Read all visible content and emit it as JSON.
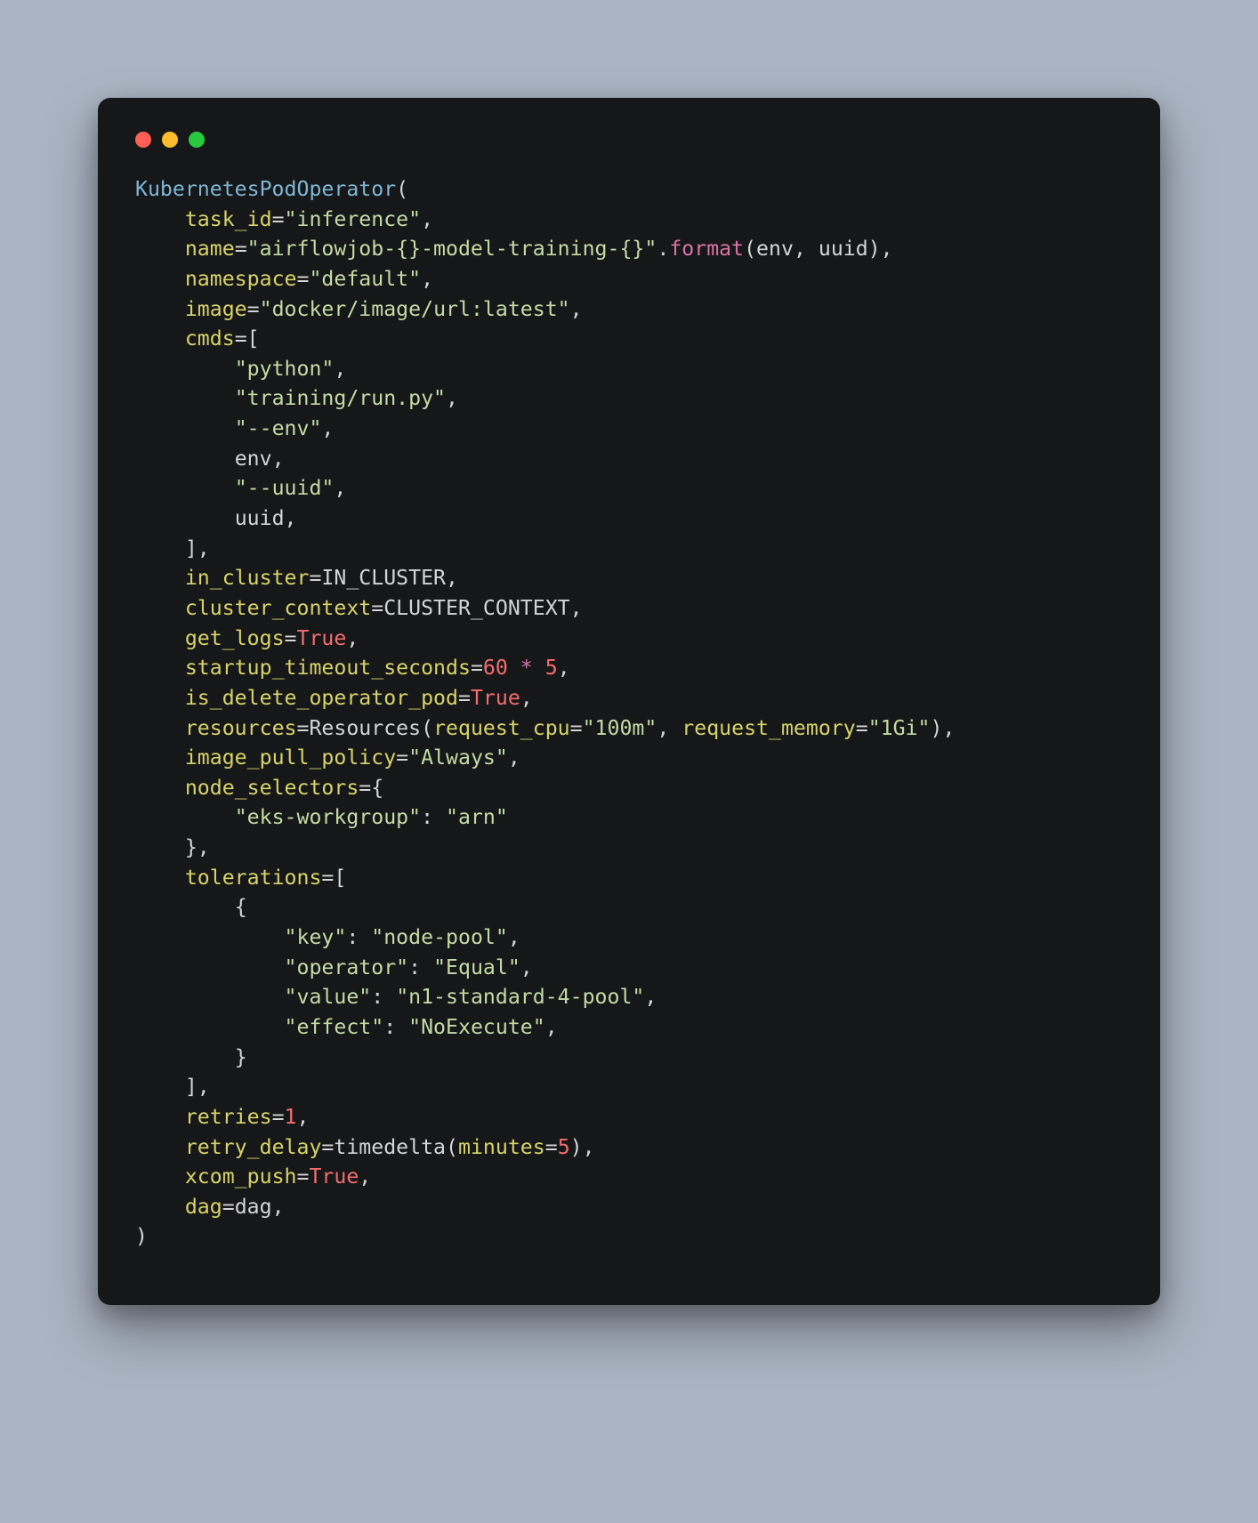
{
  "window": {
    "traffic_colors": {
      "red": "#ff5f56",
      "yellow": "#ffbd2e",
      "green": "#27c93f"
    }
  },
  "code": {
    "class_name": "KubernetesPodOperator",
    "params": {
      "task_id": {
        "key": "task_id",
        "value": "\"inference\""
      },
      "name": {
        "key": "name",
        "template": "\"airflowjob-{}-model-training-{}\"",
        "method": "format",
        "args": [
          "env",
          "uuid"
        ]
      },
      "namespace": {
        "key": "namespace",
        "value": "\"default\""
      },
      "image": {
        "key": "image",
        "value": "\"docker/image/url:latest\""
      },
      "cmds": {
        "key": "cmds",
        "items": [
          "\"python\"",
          "\"training/run.py\"",
          "\"--env\"",
          "env",
          "\"--uuid\"",
          "uuid"
        ]
      },
      "in_cluster": {
        "key": "in_cluster",
        "value": "IN_CLUSTER"
      },
      "cluster_context": {
        "key": "cluster_context",
        "value": "CLUSTER_CONTEXT"
      },
      "get_logs": {
        "key": "get_logs",
        "value": "True"
      },
      "startup_timeout_seconds": {
        "key": "startup_timeout_seconds",
        "lhs": "60",
        "op": "*",
        "rhs": "5"
      },
      "is_delete_operator_pod": {
        "key": "is_delete_operator_pod",
        "value": "True"
      },
      "resources": {
        "key": "resources",
        "callee": "Resources",
        "kwargs": [
          {
            "k": "request_cpu",
            "v": "\"100m\""
          },
          {
            "k": "request_memory",
            "v": "\"1Gi\""
          }
        ]
      },
      "image_pull_policy": {
        "key": "image_pull_policy",
        "value": "\"Always\""
      },
      "node_selectors": {
        "key": "node_selectors",
        "entries": [
          {
            "k": "\"eks-workgroup\"",
            "v": "\"arn\""
          }
        ]
      },
      "tolerations": {
        "key": "tolerations",
        "dicts": [
          [
            {
              "k": "\"key\"",
              "v": "\"node-pool\""
            },
            {
              "k": "\"operator\"",
              "v": "\"Equal\""
            },
            {
              "k": "\"value\"",
              "v": "\"n1-standard-4-pool\""
            },
            {
              "k": "\"effect\"",
              "v": "\"NoExecute\""
            }
          ]
        ]
      },
      "retries": {
        "key": "retries",
        "value": "1"
      },
      "retry_delay": {
        "key": "retry_delay",
        "callee": "timedelta",
        "kwargs": [
          {
            "k": "minutes",
            "v": "5"
          }
        ]
      },
      "xcom_push": {
        "key": "xcom_push",
        "value": "True"
      },
      "dag": {
        "key": "dag",
        "value": "dag"
      }
    }
  }
}
